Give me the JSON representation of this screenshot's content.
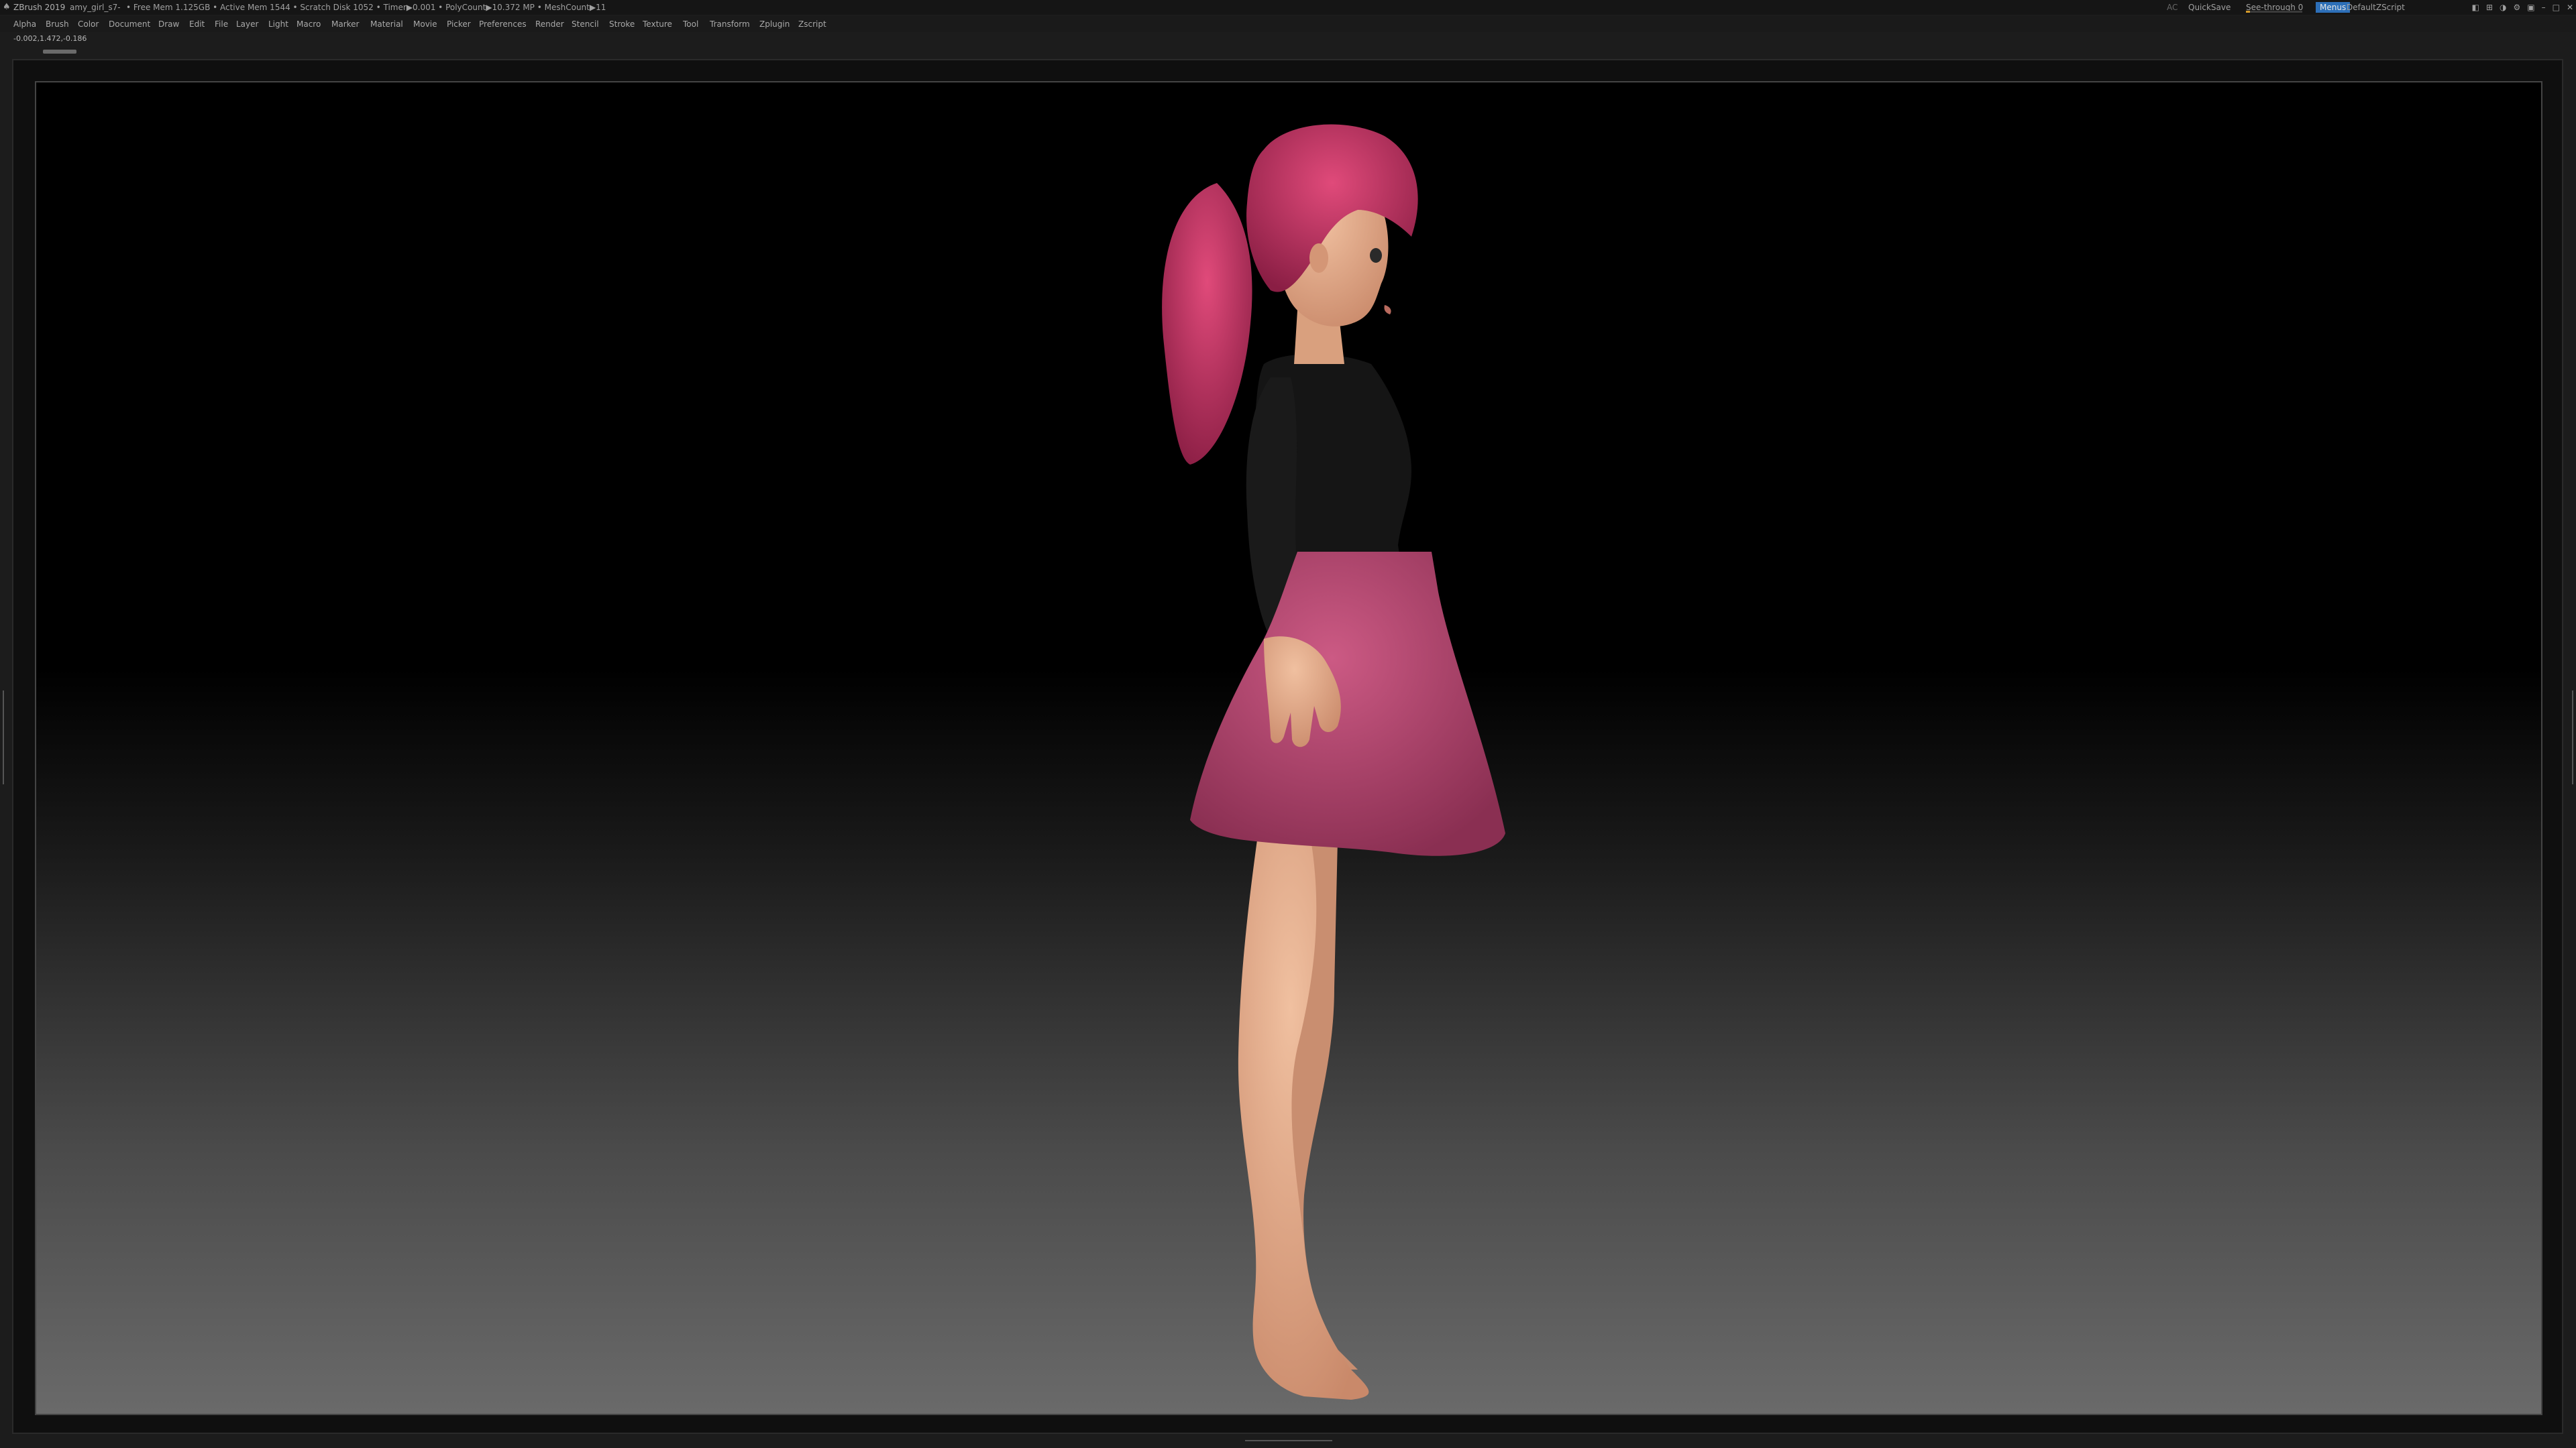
{
  "titlebar": {
    "logo_icon": "zbrush-logo",
    "app_title": "ZBrush 2019",
    "file_name": "amy_girl_s7-",
    "stats": "• Free Mem 1.125GB • Active Mem 1544 • Scratch Disk 1052 • Timer▶0.001 • PolyCount▶10.372 MP • MeshCount▶11",
    "ac_label": "AC",
    "quicksave_label": "QuickSave",
    "seethrough_label": "See-through  0",
    "seethrough_value": 0,
    "menus_label": "Menus",
    "default_script_label": "DefaultZScript"
  },
  "menubar": {
    "items": [
      "Alpha",
      "Brush",
      "Color",
      "Document",
      "Draw",
      "Edit",
      "File",
      "Layer",
      "Light",
      "Macro",
      "Marker",
      "Material",
      "Movie",
      "Picker",
      "Preferences",
      "Render",
      "Stencil",
      "Stroke",
      "Texture",
      "Tool",
      "Transform",
      "Zplugin",
      "Zscript"
    ]
  },
  "coordinates": "-0.002,1.472,-0.186",
  "colors": {
    "hair": "#c2315f",
    "skirt": "#b8456f",
    "top": "#161616",
    "skin": "#e0a884",
    "accent_blue": "#2d6fb8"
  }
}
